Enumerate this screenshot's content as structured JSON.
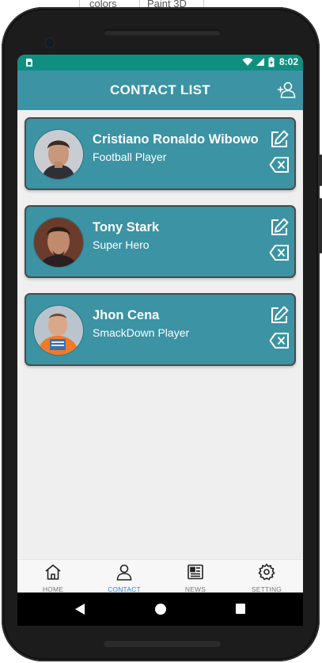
{
  "background_window": {
    "menu_labels": [
      "colors",
      "Paint 3D"
    ]
  },
  "status_bar": {
    "time": "8:02",
    "color": "#0f8f80"
  },
  "app_bar": {
    "title": "CONTACT LIST",
    "color": "#3b93a4",
    "add_icon": "add-user-icon"
  },
  "contacts": [
    {
      "name": "Cristiano Ronaldo Wibowo",
      "role": "Football Player",
      "avatar_icon": "avatar-photo"
    },
    {
      "name": "Tony Stark",
      "role": "Super Hero",
      "avatar_icon": "avatar-photo"
    },
    {
      "name": "Jhon Cena",
      "role": "SmackDown Player",
      "avatar_icon": "avatar-photo"
    }
  ],
  "bottom_nav": {
    "items": [
      {
        "label": "HOME",
        "icon": "home-icon",
        "active": false
      },
      {
        "label": "CONTACT",
        "icon": "person-icon",
        "active": true
      },
      {
        "label": "NEWS",
        "icon": "newspaper-icon",
        "active": false
      },
      {
        "label": "SETTING",
        "icon": "gear-icon",
        "active": false
      }
    ],
    "active_color": "#1e88e5"
  },
  "system_nav": {
    "buttons": [
      "back-icon",
      "home-circle-icon",
      "recents-icon"
    ]
  }
}
